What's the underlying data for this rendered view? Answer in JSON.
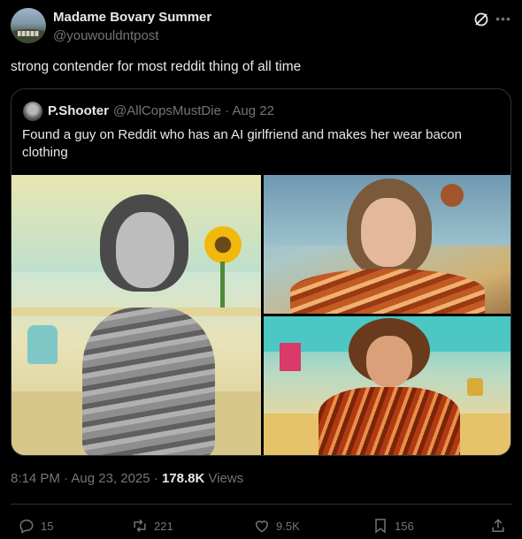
{
  "author": {
    "display_name": "Madame Bovary Summer",
    "handle": "@youwouldntpost"
  },
  "tweet": {
    "text": "strong contender for most reddit thing of all time"
  },
  "quoted": {
    "display_name": "P.Shooter",
    "handle_and_date": "@AllCopsMustDie · Aug 22",
    "text": "Found a guy on Reddit who has an AI girlfriend and makes her wear bacon clothing"
  },
  "meta": {
    "timestamp": "8:14 PM · Aug 23, 2025 · ",
    "views_count": "178.8K",
    "views_label": " Views"
  },
  "actions": {
    "replies": "15",
    "reposts": "221",
    "likes": "9.5K",
    "bookmarks": "156"
  },
  "icons": {
    "grok": "grok-icon",
    "more": "more-icon",
    "reply": "reply-icon",
    "repost": "repost-icon",
    "like": "heart-icon",
    "bookmark": "bookmark-icon",
    "share": "share-icon"
  },
  "colors": {
    "background": "#000000",
    "text_primary": "#e7e9ea",
    "text_secondary": "#71767b",
    "border": "#2f3336"
  }
}
